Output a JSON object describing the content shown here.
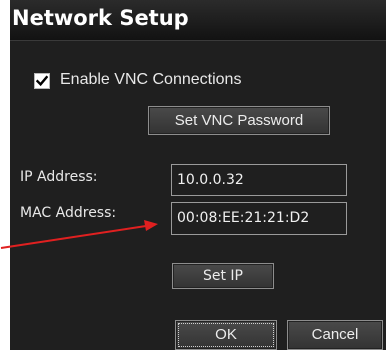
{
  "dialog": {
    "title": "Network Setup"
  },
  "vnc": {
    "enable_label": "Enable VNC Connections",
    "enabled": true,
    "set_password_label": "Set VNC Password"
  },
  "network": {
    "ip_label": "IP Address:",
    "ip_value": "10.0.0.32",
    "mac_label": "MAC Address:",
    "mac_value": "00:08:EE:21:21:D2",
    "set_ip_label": "Set IP"
  },
  "actions": {
    "ok_label": "OK",
    "cancel_label": "Cancel"
  },
  "colors": {
    "dialog_background": "#1f1f1f",
    "annotation_arrow": "#e02020"
  }
}
